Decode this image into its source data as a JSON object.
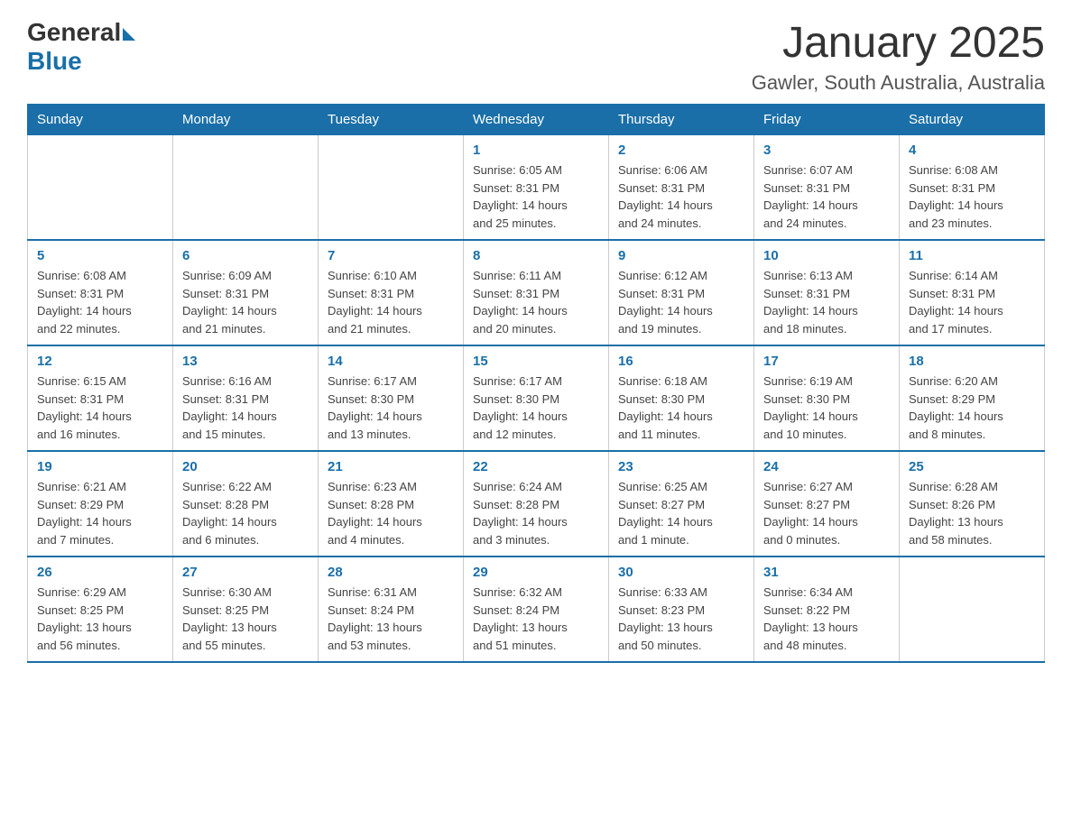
{
  "logo": {
    "text_general": "General",
    "text_blue": "Blue"
  },
  "header": {
    "title": "January 2025",
    "subtitle": "Gawler, South Australia, Australia"
  },
  "weekdays": [
    "Sunday",
    "Monday",
    "Tuesday",
    "Wednesday",
    "Thursday",
    "Friday",
    "Saturday"
  ],
  "weeks": [
    [
      {
        "day": "",
        "info": ""
      },
      {
        "day": "",
        "info": ""
      },
      {
        "day": "",
        "info": ""
      },
      {
        "day": "1",
        "info": "Sunrise: 6:05 AM\nSunset: 8:31 PM\nDaylight: 14 hours\nand 25 minutes."
      },
      {
        "day": "2",
        "info": "Sunrise: 6:06 AM\nSunset: 8:31 PM\nDaylight: 14 hours\nand 24 minutes."
      },
      {
        "day": "3",
        "info": "Sunrise: 6:07 AM\nSunset: 8:31 PM\nDaylight: 14 hours\nand 24 minutes."
      },
      {
        "day": "4",
        "info": "Sunrise: 6:08 AM\nSunset: 8:31 PM\nDaylight: 14 hours\nand 23 minutes."
      }
    ],
    [
      {
        "day": "5",
        "info": "Sunrise: 6:08 AM\nSunset: 8:31 PM\nDaylight: 14 hours\nand 22 minutes."
      },
      {
        "day": "6",
        "info": "Sunrise: 6:09 AM\nSunset: 8:31 PM\nDaylight: 14 hours\nand 21 minutes."
      },
      {
        "day": "7",
        "info": "Sunrise: 6:10 AM\nSunset: 8:31 PM\nDaylight: 14 hours\nand 21 minutes."
      },
      {
        "day": "8",
        "info": "Sunrise: 6:11 AM\nSunset: 8:31 PM\nDaylight: 14 hours\nand 20 minutes."
      },
      {
        "day": "9",
        "info": "Sunrise: 6:12 AM\nSunset: 8:31 PM\nDaylight: 14 hours\nand 19 minutes."
      },
      {
        "day": "10",
        "info": "Sunrise: 6:13 AM\nSunset: 8:31 PM\nDaylight: 14 hours\nand 18 minutes."
      },
      {
        "day": "11",
        "info": "Sunrise: 6:14 AM\nSunset: 8:31 PM\nDaylight: 14 hours\nand 17 minutes."
      }
    ],
    [
      {
        "day": "12",
        "info": "Sunrise: 6:15 AM\nSunset: 8:31 PM\nDaylight: 14 hours\nand 16 minutes."
      },
      {
        "day": "13",
        "info": "Sunrise: 6:16 AM\nSunset: 8:31 PM\nDaylight: 14 hours\nand 15 minutes."
      },
      {
        "day": "14",
        "info": "Sunrise: 6:17 AM\nSunset: 8:30 PM\nDaylight: 14 hours\nand 13 minutes."
      },
      {
        "day": "15",
        "info": "Sunrise: 6:17 AM\nSunset: 8:30 PM\nDaylight: 14 hours\nand 12 minutes."
      },
      {
        "day": "16",
        "info": "Sunrise: 6:18 AM\nSunset: 8:30 PM\nDaylight: 14 hours\nand 11 minutes."
      },
      {
        "day": "17",
        "info": "Sunrise: 6:19 AM\nSunset: 8:30 PM\nDaylight: 14 hours\nand 10 minutes."
      },
      {
        "day": "18",
        "info": "Sunrise: 6:20 AM\nSunset: 8:29 PM\nDaylight: 14 hours\nand 8 minutes."
      }
    ],
    [
      {
        "day": "19",
        "info": "Sunrise: 6:21 AM\nSunset: 8:29 PM\nDaylight: 14 hours\nand 7 minutes."
      },
      {
        "day": "20",
        "info": "Sunrise: 6:22 AM\nSunset: 8:28 PM\nDaylight: 14 hours\nand 6 minutes."
      },
      {
        "day": "21",
        "info": "Sunrise: 6:23 AM\nSunset: 8:28 PM\nDaylight: 14 hours\nand 4 minutes."
      },
      {
        "day": "22",
        "info": "Sunrise: 6:24 AM\nSunset: 8:28 PM\nDaylight: 14 hours\nand 3 minutes."
      },
      {
        "day": "23",
        "info": "Sunrise: 6:25 AM\nSunset: 8:27 PM\nDaylight: 14 hours\nand 1 minute."
      },
      {
        "day": "24",
        "info": "Sunrise: 6:27 AM\nSunset: 8:27 PM\nDaylight: 14 hours\nand 0 minutes."
      },
      {
        "day": "25",
        "info": "Sunrise: 6:28 AM\nSunset: 8:26 PM\nDaylight: 13 hours\nand 58 minutes."
      }
    ],
    [
      {
        "day": "26",
        "info": "Sunrise: 6:29 AM\nSunset: 8:25 PM\nDaylight: 13 hours\nand 56 minutes."
      },
      {
        "day": "27",
        "info": "Sunrise: 6:30 AM\nSunset: 8:25 PM\nDaylight: 13 hours\nand 55 minutes."
      },
      {
        "day": "28",
        "info": "Sunrise: 6:31 AM\nSunset: 8:24 PM\nDaylight: 13 hours\nand 53 minutes."
      },
      {
        "day": "29",
        "info": "Sunrise: 6:32 AM\nSunset: 8:24 PM\nDaylight: 13 hours\nand 51 minutes."
      },
      {
        "day": "30",
        "info": "Sunrise: 6:33 AM\nSunset: 8:23 PM\nDaylight: 13 hours\nand 50 minutes."
      },
      {
        "day": "31",
        "info": "Sunrise: 6:34 AM\nSunset: 8:22 PM\nDaylight: 13 hours\nand 48 minutes."
      },
      {
        "day": "",
        "info": ""
      }
    ]
  ]
}
